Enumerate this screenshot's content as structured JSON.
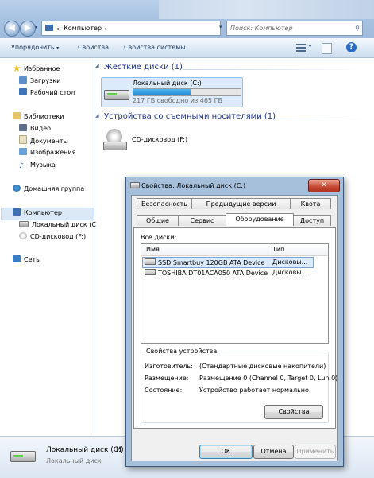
{
  "window": {
    "address_path": "Компьютер",
    "search_placeholder": "Поиск: Компьютер"
  },
  "toolbar": {
    "organize": "Упорядочить",
    "properties": "Свойства",
    "system_properties": "Свойства системы"
  },
  "sidebar": {
    "favorites": "Избранное",
    "downloads": "Загрузки",
    "desktop": "Рабочий стол",
    "libraries": "Библиотеки",
    "video": "Видео",
    "documents": "Документы",
    "images": "Изображения",
    "music": "Музыка",
    "homegroup": "Домашняя группа",
    "computer": "Компьютер",
    "local_disk": "Локальный диск (C",
    "cd_drive": "CD-дисковод (F:)",
    "network": "Сеть"
  },
  "content": {
    "hard_disks_title": "Жесткие диски (1)",
    "local_disk_name": "Локальный диск (C:)",
    "local_disk_space": "217 ГБ свободно из 465 ГБ",
    "local_disk_used_fraction": 0.53,
    "removable_title": "Устройства со съемными носителями (1)",
    "cd_drive_name": "CD-дисковод (F:)"
  },
  "dialog": {
    "title": "Свойства: Локальный диск (C:)",
    "tabs_row1": [
      "Безопасность",
      "Предыдущие версии",
      "Квота"
    ],
    "tabs_row2": [
      "Общие",
      "Сервис",
      "Оборудование",
      "Доступ"
    ],
    "all_disks_label": "Все диски:",
    "columns": [
      "Имя",
      "Тип"
    ],
    "disks": [
      {
        "name": "SSD Smartbuy 120GB ATA Device",
        "type": "Дисковы..."
      },
      {
        "name": "TOSHIBA DT01ACA050 ATA Device",
        "type": "Дисковы..."
      }
    ],
    "device_props_title": "Свойства устройства",
    "manufacturer_label": "Изготовитель:",
    "manufacturer_value": "(Стандартные дисковые накопители)",
    "location_label": "Размещение:",
    "location_value": "Размещение 0 (Channel 0, Target 0, Lun 0)",
    "status_label": "Состояние:",
    "status_value": "Устройство работает нормально.",
    "properties_button": "Свойства",
    "ok_button": "ОК",
    "cancel_button": "Отмена",
    "apply_button": "Применить",
    "close_glyph": "✕"
  },
  "statusbar": {
    "item_name": "Локальный диск (C:)",
    "item_type": "Локальный диск",
    "truncated": "И"
  }
}
